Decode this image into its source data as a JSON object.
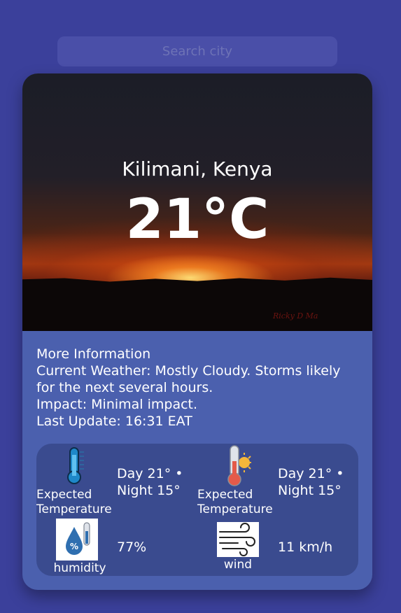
{
  "search": {
    "placeholder": "Search city"
  },
  "hero": {
    "location": "Kilimani, Kenya",
    "temperature": "21°C",
    "photo_signature": "Ricky D Ma"
  },
  "info": {
    "heading": "More Information",
    "current_weather": "Current Weather: Mostly Cloudy. Storms likely for the next several hours.",
    "impact": "Impact: Minimal impact.",
    "last_update": "Last Update: 16:31 EAT"
  },
  "details": {
    "expected_1": {
      "icon": "thermometer-icon",
      "label": "Expected Temperature",
      "value": "Day 21° • Night 15°"
    },
    "expected_2": {
      "icon": "thermometer-sun-icon",
      "label": "Expected Temperature",
      "value": "Day 21° • Night 15°"
    },
    "humidity": {
      "icon": "humidity-icon",
      "label": "humidity",
      "value": "77%"
    },
    "wind": {
      "icon": "wind-icon",
      "label": "wind",
      "value": "11 km/h"
    }
  },
  "colors": {
    "page_background": "#3b409b",
    "card_background": "#4b60ae",
    "panel_background": "#3a4b8f",
    "search_background": "#4a4fa8"
  }
}
